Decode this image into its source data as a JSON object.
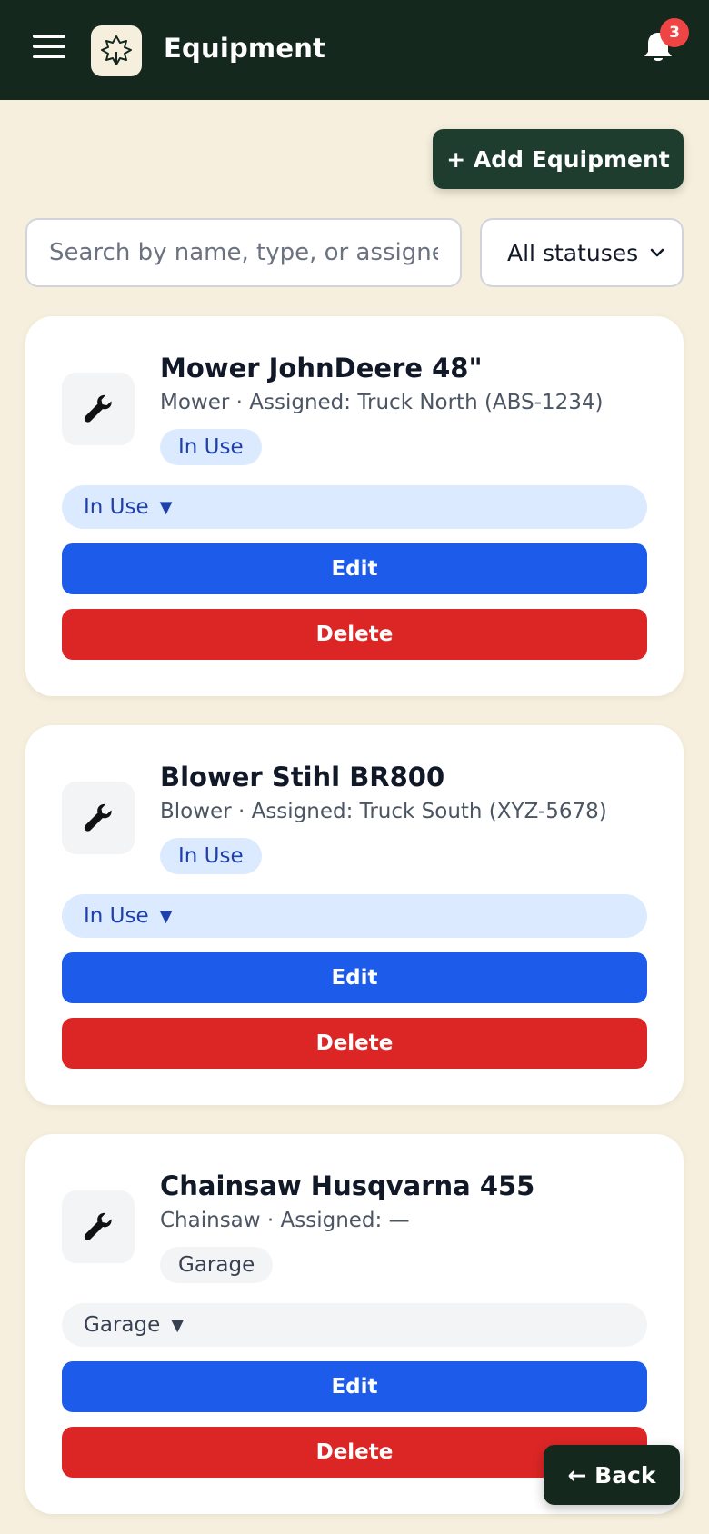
{
  "header": {
    "title": "Equipment",
    "notification_count": "3",
    "icons": {
      "menu": "hamburger-icon",
      "logo": "leaf-logo-icon",
      "notifications": "bell-icon"
    }
  },
  "toolbar": {
    "add_label": "+ Add Equipment"
  },
  "filters": {
    "search_placeholder": "Search by name, type, or assignee",
    "status_selected": "All statuses"
  },
  "equipment": [
    {
      "name": "Mower JohnDeere 48\"",
      "subtitle": "Mower · Assigned: Truck North (ABS-1234)",
      "status": "In Use",
      "status_dropdown": "In Use",
      "edit_label": "Edit",
      "delete_label": "Delete"
    },
    {
      "name": "Blower Stihl BR800",
      "subtitle": "Blower · Assigned: Truck South (XYZ-5678)",
      "status": "In Use",
      "status_dropdown": "In Use",
      "edit_label": "Edit",
      "delete_label": "Delete"
    },
    {
      "name": "Chainsaw Husqvarna 455",
      "subtitle": "Chainsaw · Assigned: —",
      "status": "Garage",
      "status_dropdown": "Garage",
      "edit_label": "Edit",
      "delete_label": "Delete"
    }
  ],
  "footer": {
    "back_label": "← Back"
  },
  "colors": {
    "header_bg": "#14281d",
    "page_bg": "#f6efdd",
    "primary": "#1d5bea",
    "danger": "#dc2626",
    "in_use_bg": "#dbeafe",
    "in_use_text": "#1e40af",
    "garage_bg": "#f3f4f6"
  }
}
